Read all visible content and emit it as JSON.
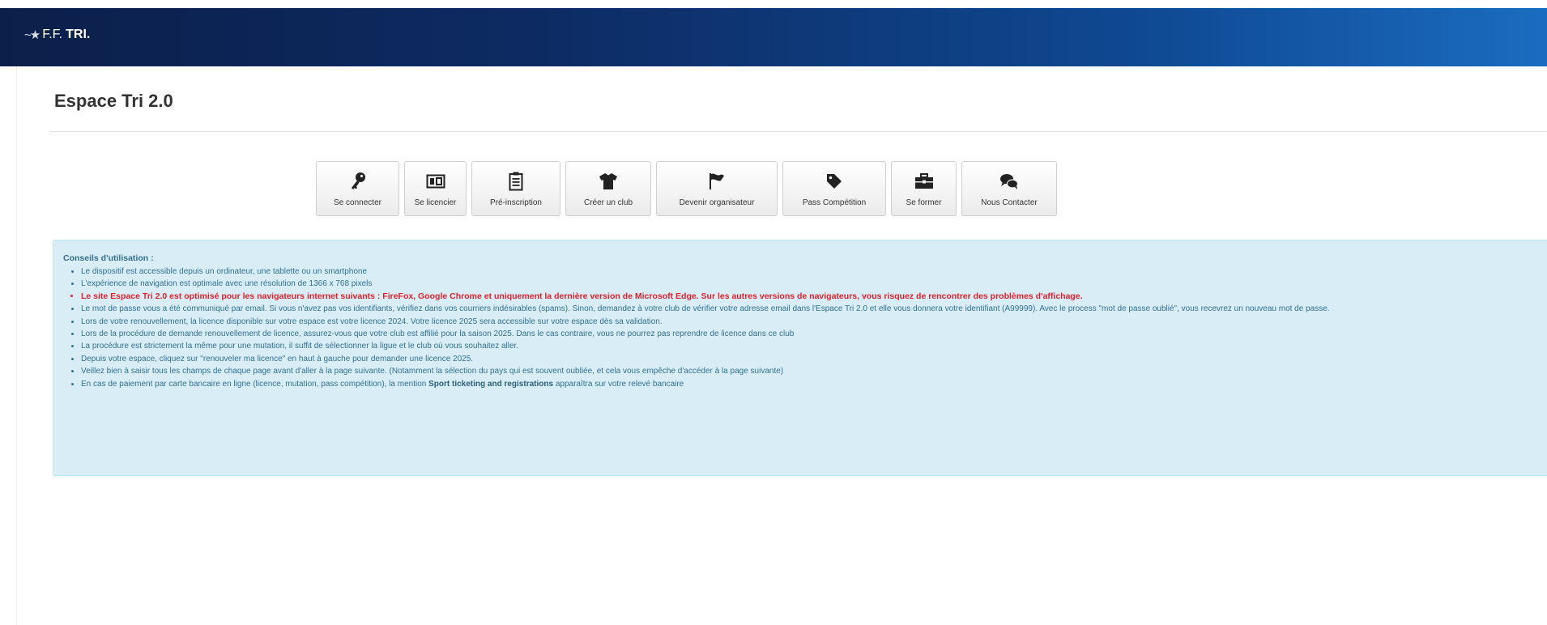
{
  "header": {
    "logo_ff": "F.F.",
    "logo_tri": "TRI."
  },
  "page": {
    "title": "Espace Tri 2.0"
  },
  "menu": [
    {
      "label": "Se connecter",
      "icon": "key-icon"
    },
    {
      "label": "Se licencier",
      "icon": "id-card-icon"
    },
    {
      "label": "Pré-inscription",
      "icon": "clipboard-icon"
    },
    {
      "label": "Créer un club",
      "icon": "tshirt-icon"
    },
    {
      "label": "Devenir organisateur",
      "icon": "flag-icon"
    },
    {
      "label": "Pass Compétition",
      "icon": "tag-icon"
    },
    {
      "label": "Se former",
      "icon": "briefcase-icon"
    },
    {
      "label": "Nous Contacter",
      "icon": "chat-icon"
    }
  ],
  "tips": {
    "title": "Conseils d'utilisation :",
    "items": [
      "Le dispositif est accessible depuis un ordinateur, une tablette ou un smartphone",
      "L'expérience de navigation est optimale avec une résolution de 1366 x 768 pixels",
      "Le site Espace Tri 2.0 est optimisé pour les navigateurs internet suivants : FireFox, Google Chrome et uniquement la dernière version de Microsoft Edge. Sur les autres versions de navigateurs, vous risquez de rencontrer des problèmes d'affichage.",
      "Le mot de passe vous a été communiqué par email. Si vous n'avez pas vos identifiants, vérifiez dans vos courriers indésirables (spams). Sinon, demandez à votre club de vérifier votre adresse email dans l'Espace Tri 2.0 et elle vous donnera votre identifiant (A99999). Avec le process \"mot de passe oublié\", vous recevrez un nouveau mot de passe.",
      "Lors de votre renouvellement, la licence disponible sur votre espace est votre licence 2024. Votre licence 2025 sera accessible sur votre espace dès sa validation.",
      "Lors de la procédure de demande renouvellement de licence, assurez-vous que votre club est affilié pour la saison 2025. Dans le cas contraire, vous ne pourrez pas reprendre de licence dans ce club",
      "La procédure est strictement la même pour une mutation, il suffit de sélectionner la ligue et le club où vous souhaitez aller.",
      "Depuis votre espace, cliquez sur \"renouveler ma licence\" en haut à gauche pour demander une licence 2025.",
      "Veillez bien à saisir tous les champs de chaque page avant d'aller à la page suivante. (Notamment la sélection du pays qui est souvent oubliée, et cela vous empêche d'accéder à la page suivante)"
    ],
    "last_item": {
      "before": "En cas de paiement par carte bancaire en ligne (licence, mutation, pass compétition), la mention ",
      "bold": "Sport ticketing and registrations",
      "after": " apparaîtra sur votre relevé bancaire"
    }
  },
  "colors": {
    "header_start": "#0c1f4a",
    "header_end": "#1b6cc0",
    "tips_bg": "#d9edf7",
    "tips_text": "#31708f",
    "warning_text": "#e0212b"
  }
}
